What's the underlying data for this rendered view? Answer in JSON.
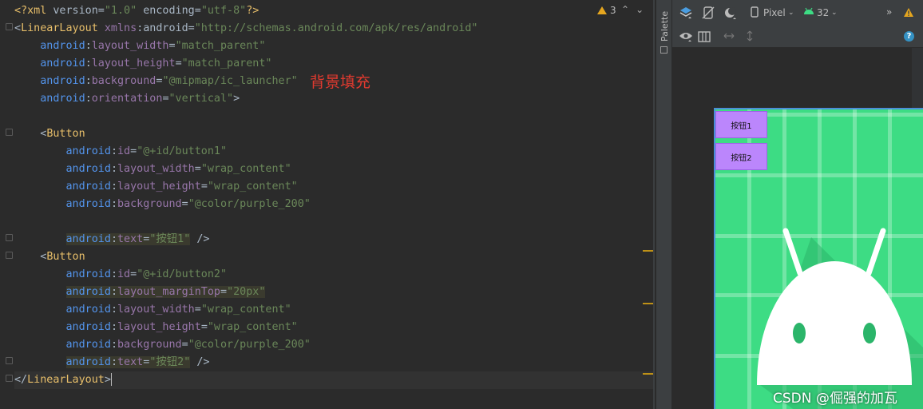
{
  "editor": {
    "lines": [
      "<?xml version=\"1.0\" encoding=\"utf-8\"?>",
      "<LinearLayout xmlns:android=\"http://schemas.android.com/apk/res/android\"",
      "    android:layout_width=\"match_parent\"",
      "    android:layout_height=\"match_parent\"",
      "    android:background=\"@mipmap/ic_launcher\"",
      "    android:orientation=\"vertical\">",
      "",
      "    <Button",
      "        android:id=\"@+id/button1\"",
      "        android:layout_width=\"wrap_content\"",
      "        android:layout_height=\"wrap_content\"",
      "        android:background=\"@color/purple_200\"",
      "",
      "        android:text=\"按钮1\" />",
      "    <Button",
      "        android:id=\"@+id/button2\"",
      "        android:layout_marginTop=\"20px\"",
      "        android:layout_width=\"wrap_content\"",
      "        android:layout_height=\"wrap_content\"",
      "        android:background=\"@color/purple_200\"",
      "        android:text=\"按钮2\" />",
      "</LinearLayout>"
    ],
    "annotation": "背景填充",
    "warning_count": "3"
  },
  "palette": {
    "label": "Palette"
  },
  "design": {
    "device_name": "Pixel",
    "api_level": "32",
    "preview": {
      "button1_label": "按钮1",
      "button2_label": "按钮2"
    }
  },
  "watermark": "CSDN @倔强的加瓦",
  "colors": {
    "button_fill": "#bb86fc",
    "background_green": "#3ddc84",
    "warning": "#e5a61f",
    "annotation_red": "#e03a2f"
  }
}
